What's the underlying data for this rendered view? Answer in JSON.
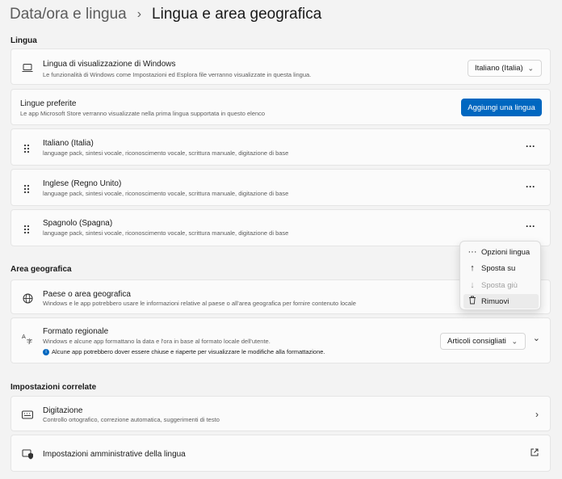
{
  "breadcrumb": {
    "parent": "Data/ora e lingua",
    "separator": "›",
    "current": "Lingua e area geografica"
  },
  "sections": {
    "lingua": "Lingua",
    "area": "Area geografica",
    "correlate": "Impostazioni correlate"
  },
  "display_language": {
    "title": "Lingua di visualizzazione di Windows",
    "desc": "Le funzionalità di Windows come Impostazioni ed Esplora file verranno visualizzate in questa lingua.",
    "value": "Italiano (Italia)"
  },
  "preferred": {
    "title": "Lingue preferite",
    "desc": "Le app Microsoft Store verranno visualizzate nella prima lingua supportata in questo elenco",
    "add_button": "Aggiungi una lingua"
  },
  "languages": [
    {
      "name": "Italiano (Italia)",
      "features": "language pack, sintesi vocale, riconoscimento vocale, scrittura manuale, digitazione di base"
    },
    {
      "name": "Inglese (Regno Unito)",
      "features": "language pack, sintesi vocale, riconoscimento vocale, scrittura manuale, digitazione di base"
    },
    {
      "name": "Spagnolo (Spagna)",
      "features": "language pack, sintesi vocale, riconoscimento vocale, scrittura manuale, digitazione di base"
    }
  ],
  "more_label": "···",
  "context_menu": {
    "items": [
      {
        "label": "Opzioni lingua",
        "icon": "ellipsis-icon"
      },
      {
        "label": "Sposta su",
        "icon": "arrow-up-icon"
      },
      {
        "label": "Sposta giù",
        "icon": "arrow-down-icon",
        "disabled": true
      },
      {
        "label": "Rimuovi",
        "icon": "trash-icon"
      }
    ]
  },
  "country": {
    "title": "Paese o area geografica",
    "desc": "Windows e le app potrebbero usare le informazioni relative al paese o all'area geografica per fornire contenuto locale"
  },
  "regional": {
    "title": "Formato regionale",
    "desc": "Windows e alcune app formattano la data e l'ora in base al formato locale dell'utente.",
    "warning": "Alcune app potrebbero dover essere chiuse e riaperte per visualizzare le modifiche alla formattazione.",
    "value": "Articoli consigliati"
  },
  "typing": {
    "title": "Digitazione",
    "desc": "Controllo ortografico, correzione automatica, suggerimenti di testo"
  },
  "admin": {
    "title": "Impostazioni amministrative della lingua"
  },
  "colors": {
    "accent": "#0067c0",
    "background": "#f3f3f3",
    "card": "#fbfbfb"
  }
}
